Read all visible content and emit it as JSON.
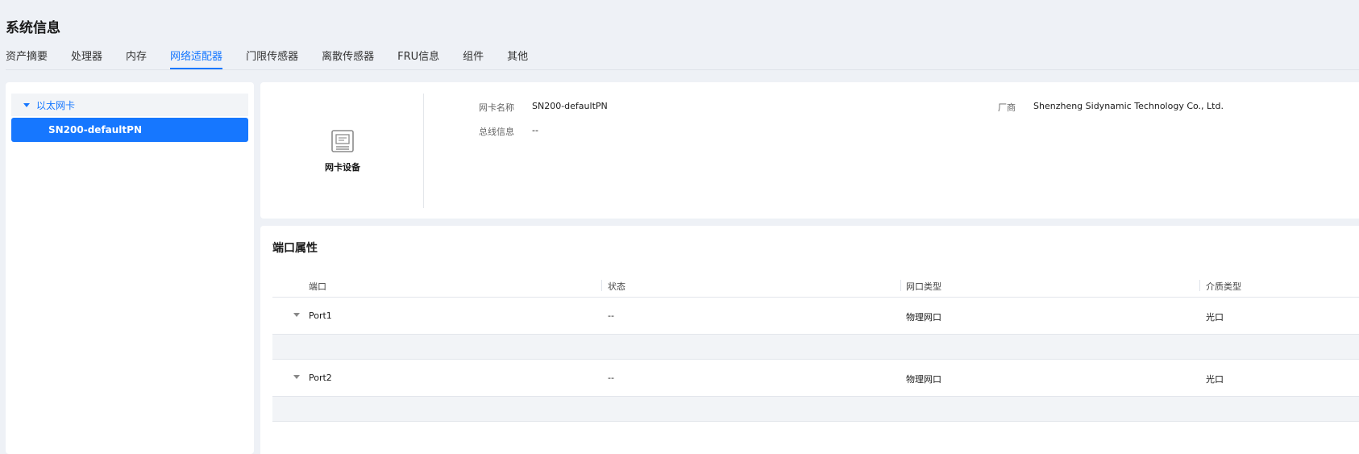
{
  "page": {
    "title": "系统信息"
  },
  "tabs": [
    {
      "label": "资产摘要",
      "active": false
    },
    {
      "label": "处理器",
      "active": false
    },
    {
      "label": "内存",
      "active": false
    },
    {
      "label": "网络适配器",
      "active": true
    },
    {
      "label": "门限传感器",
      "active": false
    },
    {
      "label": "离散传感器",
      "active": false
    },
    {
      "label": "FRU信息",
      "active": false
    },
    {
      "label": "组件",
      "active": false
    },
    {
      "label": "其他",
      "active": false
    }
  ],
  "tree": {
    "group_label": "以太网卡",
    "items": [
      {
        "label": "SN200-defaultPN",
        "selected": true
      }
    ]
  },
  "device": {
    "icon": "network-card-icon",
    "label": "网卡设备",
    "fields": {
      "name_label": "网卡名称",
      "name_value": "SN200-defaultPN",
      "bus_label": "总线信息",
      "bus_value": "--",
      "vendor_label": "厂商",
      "vendor_value": "Shenzheng Sidynamic Technology Co., Ltd."
    }
  },
  "ports": {
    "title": "端口属性",
    "columns": [
      "端口",
      "状态",
      "网口类型",
      "介质类型"
    ],
    "rows": [
      {
        "port": "Port1",
        "status": "--",
        "type": "物理网口",
        "media": "光口"
      },
      {
        "port": "Port2",
        "status": "--",
        "type": "物理网口",
        "media": "光口"
      }
    ]
  },
  "colors": {
    "accent": "#1677ff",
    "background": "#eef1f6",
    "card": "#ffffff"
  }
}
